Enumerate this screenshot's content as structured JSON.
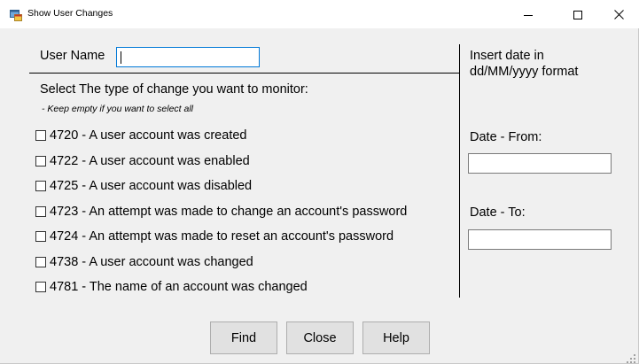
{
  "window": {
    "title": "Show User Changes",
    "icons": {
      "app": "app-window-icon",
      "minimize": "minimize-icon",
      "maximize": "maximize-icon",
      "close": "close-icon"
    }
  },
  "form": {
    "user_name_label": "User Name",
    "user_name_value": "",
    "select_prompt": "Select The type of change you want to monitor:",
    "select_hint": "- Keep empty if you want to select all",
    "events": [
      {
        "label": "4720 - A user account was created",
        "checked": false
      },
      {
        "label": "4722 - A user account was enabled",
        "checked": false
      },
      {
        "label": "4725 - A user account was disabled",
        "checked": false
      },
      {
        "label": "4723 - An attempt was made to change an account's password",
        "checked": false
      },
      {
        "label": "4724 - An attempt was made to reset an account's password",
        "checked": false
      },
      {
        "label": "4738 - A user account was changed",
        "checked": false
      },
      {
        "label": "4781 - The name of an account was changed",
        "checked": false
      }
    ]
  },
  "dates": {
    "instructions_line1": "Insert date in",
    "instructions_line2": "dd/MM/yyyy format",
    "from_label": "Date - From:",
    "from_value": "",
    "to_label": "Date - To:",
    "to_value": ""
  },
  "buttons": {
    "find": "Find",
    "close": "Close",
    "help": "Help"
  },
  "colors": {
    "window_bg": "#f0f0f0",
    "focus_border": "#0078d7",
    "button_bg": "#e1e1e1"
  }
}
